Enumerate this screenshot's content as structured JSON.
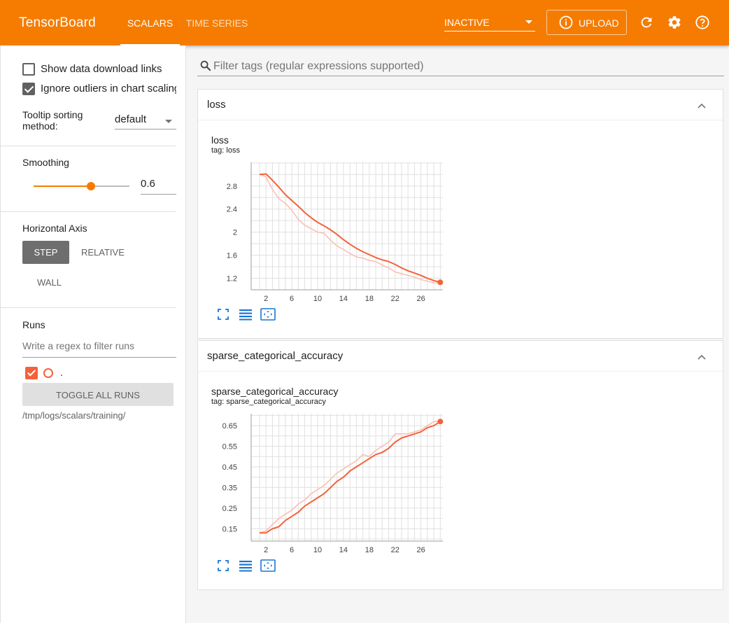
{
  "header": {
    "brand": "TensorBoard",
    "tabs": [
      {
        "label": "SCALARS",
        "active": true
      },
      {
        "label": "TIME SERIES",
        "active": false
      }
    ],
    "status_select": "INACTIVE",
    "upload_label": "UPLOAD",
    "accent_color": "#f57c00",
    "icons": [
      "refresh-icon",
      "settings-icon",
      "help-icon"
    ]
  },
  "sidebar": {
    "show_download_links": {
      "label": "Show data download links",
      "checked": false
    },
    "ignore_outliers": {
      "label": "Ignore outliers in chart scaling",
      "checked": true
    },
    "tooltip_sorting": {
      "label": "Tooltip sorting method:",
      "value": "default"
    },
    "smoothing": {
      "label": "Smoothing",
      "value": "0.6",
      "fraction": 0.6
    },
    "horizontal_axis": {
      "label": "Horizontal Axis",
      "options": [
        "STEP",
        "RELATIVE",
        "WALL"
      ],
      "selected": "STEP"
    },
    "runs": {
      "label": "Runs",
      "filter_placeholder": "Write a regex to filter runs",
      "run_name": ".",
      "run_color": "#f4623a",
      "toggle_label": "TOGGLE ALL RUNS",
      "path": "/tmp/logs/scalars/training/"
    }
  },
  "main": {
    "filter_placeholder": "Filter tags (regular expressions supported)",
    "cards": [
      {
        "header": "loss",
        "chart_title": "loss",
        "chart_tag": "tag: loss"
      },
      {
        "header": "sparse_categorical_accuracy",
        "chart_title": "sparse_categorical_accuracy",
        "chart_tag": "tag: sparse_categorical_accuracy"
      }
    ]
  },
  "chart_data": [
    {
      "type": "line",
      "title": "loss",
      "subtitle": "tag: loss",
      "x_ticks": [
        2,
        6,
        10,
        14,
        18,
        22,
        26
      ],
      "y_ticks": [
        1.2,
        1.6,
        2,
        2.4,
        2.8
      ],
      "xlim": [
        -0.3,
        29.4
      ],
      "ylim": [
        1.0,
        3.21
      ],
      "grid": true,
      "series": [
        {
          "role": "raw",
          "color": "#f9c0b4",
          "x": [
            1,
            2,
            3,
            4,
            5,
            6,
            7,
            8,
            9,
            10,
            11,
            12,
            13,
            14,
            15,
            16,
            17,
            18,
            19,
            20,
            21,
            22,
            23,
            24,
            25,
            26,
            27,
            28,
            29
          ],
          "y": [
            3.01,
            2.96,
            2.74,
            2.58,
            2.5,
            2.38,
            2.22,
            2.12,
            2.06,
            2.0,
            1.98,
            1.86,
            1.76,
            1.7,
            1.63,
            1.57,
            1.55,
            1.51,
            1.49,
            1.43,
            1.38,
            1.31,
            1.28,
            1.25,
            1.22,
            1.18,
            1.15,
            1.12,
            1.12
          ]
        },
        {
          "role": "smoothed",
          "color": "#f4623a",
          "x": [
            1,
            2,
            3,
            4,
            5,
            6,
            7,
            8,
            9,
            10,
            11,
            12,
            13,
            14,
            15,
            16,
            17,
            18,
            19,
            20,
            21,
            22,
            23,
            24,
            25,
            26,
            27,
            28,
            29
          ],
          "y": [
            3.0,
            3.01,
            2.9,
            2.78,
            2.65,
            2.55,
            2.45,
            2.34,
            2.25,
            2.17,
            2.11,
            2.04,
            1.96,
            1.87,
            1.79,
            1.72,
            1.66,
            1.61,
            1.56,
            1.52,
            1.49,
            1.44,
            1.38,
            1.33,
            1.29,
            1.25,
            1.2,
            1.16,
            1.13
          ]
        }
      ]
    },
    {
      "type": "line",
      "title": "sparse_categorical_accuracy",
      "subtitle": "tag: sparse_categorical_accuracy",
      "x_ticks": [
        2,
        6,
        10,
        14,
        18,
        22,
        26
      ],
      "y_ticks": [
        0.15,
        0.25,
        0.35,
        0.45,
        0.55,
        0.65
      ],
      "xlim": [
        -0.3,
        29.4
      ],
      "ylim": [
        0.09,
        0.708
      ],
      "grid": true,
      "series": [
        {
          "role": "raw",
          "color": "#f9c0b4",
          "x": [
            1,
            2,
            3,
            4,
            5,
            6,
            7,
            8,
            9,
            10,
            11,
            12,
            13,
            14,
            15,
            16,
            17,
            18,
            19,
            20,
            21,
            22,
            23,
            24,
            25,
            26,
            27,
            28,
            29
          ],
          "y": [
            0.13,
            0.14,
            0.17,
            0.2,
            0.22,
            0.24,
            0.27,
            0.29,
            0.32,
            0.34,
            0.36,
            0.39,
            0.42,
            0.44,
            0.46,
            0.48,
            0.51,
            0.5,
            0.53,
            0.55,
            0.57,
            0.61,
            0.61,
            0.61,
            0.62,
            0.63,
            0.65,
            0.67,
            0.67
          ]
        },
        {
          "role": "smoothed",
          "color": "#f4623a",
          "x": [
            1,
            2,
            3,
            4,
            5,
            6,
            7,
            8,
            9,
            10,
            11,
            12,
            13,
            14,
            15,
            16,
            17,
            18,
            19,
            20,
            21,
            22,
            23,
            24,
            25,
            26,
            27,
            28,
            29
          ],
          "y": [
            0.13,
            0.13,
            0.15,
            0.16,
            0.19,
            0.21,
            0.23,
            0.26,
            0.28,
            0.3,
            0.32,
            0.35,
            0.38,
            0.4,
            0.43,
            0.45,
            0.47,
            0.49,
            0.51,
            0.52,
            0.54,
            0.57,
            0.59,
            0.6,
            0.61,
            0.62,
            0.64,
            0.65,
            0.67
          ]
        }
      ]
    }
  ]
}
